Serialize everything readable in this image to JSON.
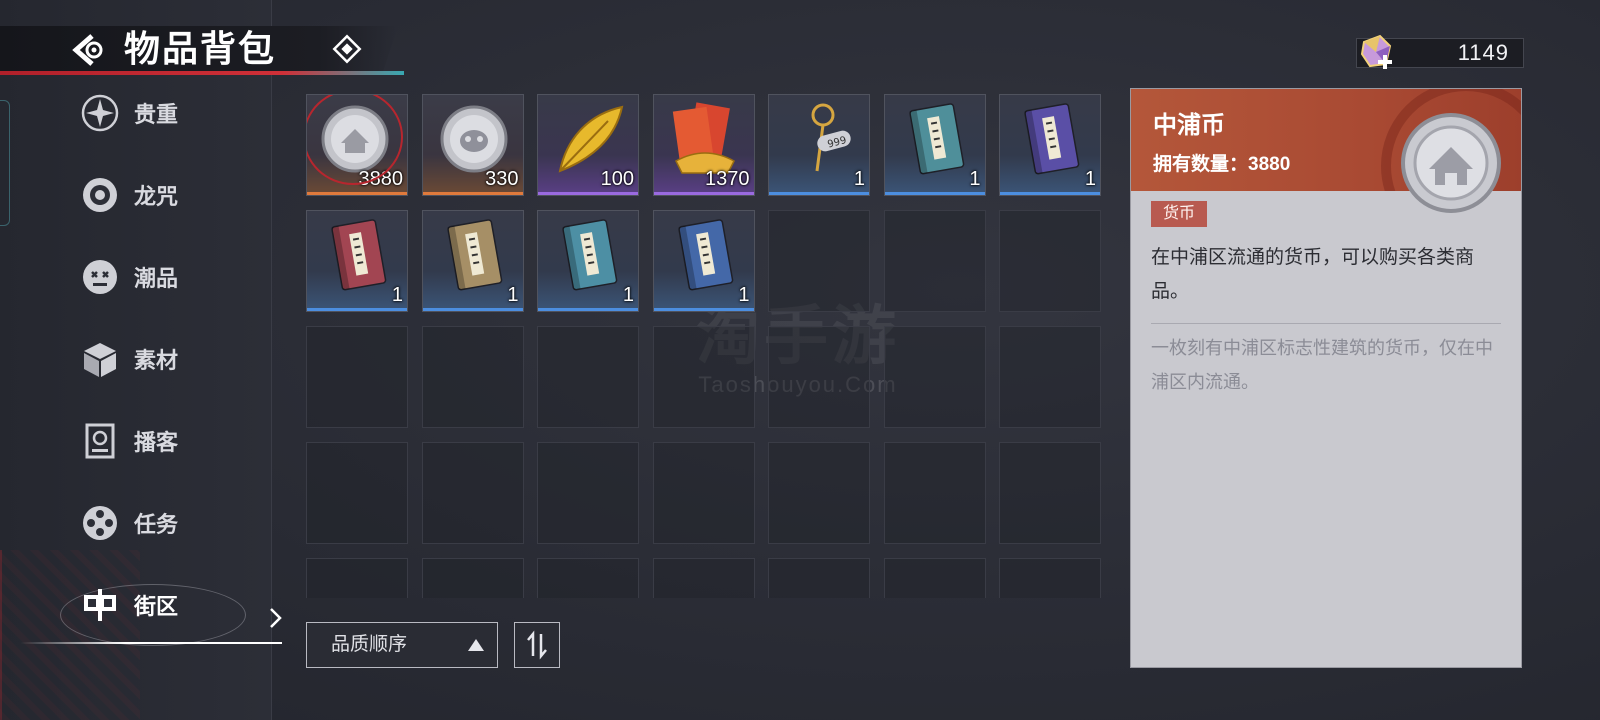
{
  "header": {
    "title": "物品背包"
  },
  "currency": {
    "value": "1149"
  },
  "sidebar": {
    "items": [
      {
        "label": "贵重"
      },
      {
        "label": "龙咒"
      },
      {
        "label": "潮品"
      },
      {
        "label": "素材"
      },
      {
        "label": "播客"
      },
      {
        "label": "任务"
      },
      {
        "label": "街区"
      }
    ],
    "active": "街区"
  },
  "inventory": {
    "items": [
      {
        "icon": "silver-coin-icon",
        "count": "3880",
        "quality": "gold",
        "selected": true
      },
      {
        "icon": "mask-coin-icon",
        "count": "330",
        "quality": "gold"
      },
      {
        "icon": "gold-feather-icon",
        "count": "100",
        "quality": "purple"
      },
      {
        "icon": "red-envelope-icon",
        "count": "1370",
        "quality": "purple"
      },
      {
        "icon": "key-tag-icon",
        "count": "1",
        "quality": "blue"
      },
      {
        "icon": "book-teal-icon",
        "count": "1",
        "quality": "blue"
      },
      {
        "icon": "book-purple-icon",
        "count": "1",
        "quality": "blue"
      },
      {
        "icon": "book-red-icon",
        "count": "1",
        "quality": "blue"
      },
      {
        "icon": "book-tan-icon",
        "count": "1",
        "quality": "blue"
      },
      {
        "icon": "book-cyan-icon",
        "count": "1",
        "quality": "blue"
      },
      {
        "icon": "book-blue-icon",
        "count": "1",
        "quality": "blue"
      }
    ]
  },
  "sort": {
    "label": "品质顺序"
  },
  "detail": {
    "name": "中浦币",
    "owned": "拥有数量：3880",
    "tag": "货币",
    "description": "在中浦区流通的货币，可以购买各类商品。",
    "flavor": "一枚刻有中浦区标志性建筑的货币，仅在中浦区内流通。"
  },
  "watermark": {
    "cn": "淘手游",
    "en": "Taoshouyou.Com"
  },
  "colors": {
    "accent_red": "#b7262e",
    "detail_header": "#b4573a",
    "tag": "#b85a50"
  }
}
